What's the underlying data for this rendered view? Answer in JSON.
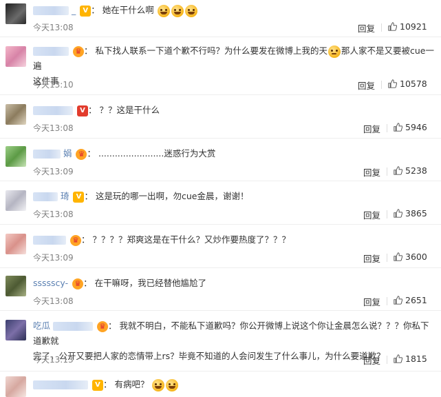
{
  "comments": [
    {
      "user": "",
      "badge": "V",
      "text": "她在干什么啊",
      "emojis": 3,
      "time": "今天13:08",
      "reply": "回复",
      "likes": "10921"
    },
    {
      "user": "",
      "badge": "crown",
      "text": "私下找人联系一下道个歉不行吗？为什么要发在微博上我的天",
      "text2": "那人家不是又要被cue一遍",
      "cont": "这件事",
      "time": "今天13:10",
      "reply": "回复",
      "likes": "10578"
    },
    {
      "user": "",
      "badge": "V",
      "text": "？？这是干什么",
      "time": "今天13:08",
      "reply": "回复",
      "likes": "5946"
    },
    {
      "user": "娟",
      "badge": "crown",
      "text": "........................迷惑行为大赏",
      "time": "今天13:09",
      "reply": "回复",
      "likes": "5238"
    },
    {
      "user": "琦",
      "badge": "V",
      "text": "这是玩的哪一出啊，勿cue金晨，谢谢！",
      "time": "今天13:08",
      "reply": "回复",
      "likes": "3865"
    },
    {
      "user": "",
      "badge": "crown",
      "text": "？？？？郑爽这是在干什么？又炒作要热度了？？？",
      "time": "今天13:09",
      "reply": "回复",
      "likes": "3600"
    },
    {
      "user": "ssssscy-",
      "badge": "crown",
      "text": "在干嘛呀，我已经替他尴尬了",
      "time": "今天13:08",
      "reply": "回复",
      "likes": "2651"
    },
    {
      "user": "吃瓜",
      "badge": "crown",
      "text": "我就不明白，不能私下道歉吗？你公开微博上说这个你让金晨怎么说？？？你私下道歉就",
      "cont": "完了，公开又要把人家的恋情带上rs？毕竟不知道的人会问发生了什么事儿，为什么要道歉？",
      "time": "今天13:13",
      "reply": "回复",
      "likes": "1815"
    },
    {
      "user": "",
      "badge": "V",
      "text": "有病吧？",
      "emojis": 2
    }
  ],
  "colors": {
    "link": "#5b80b2",
    "time": "#808080",
    "text": "#333333",
    "v_badge": "#ffb400",
    "divider": "#eeeeee"
  }
}
